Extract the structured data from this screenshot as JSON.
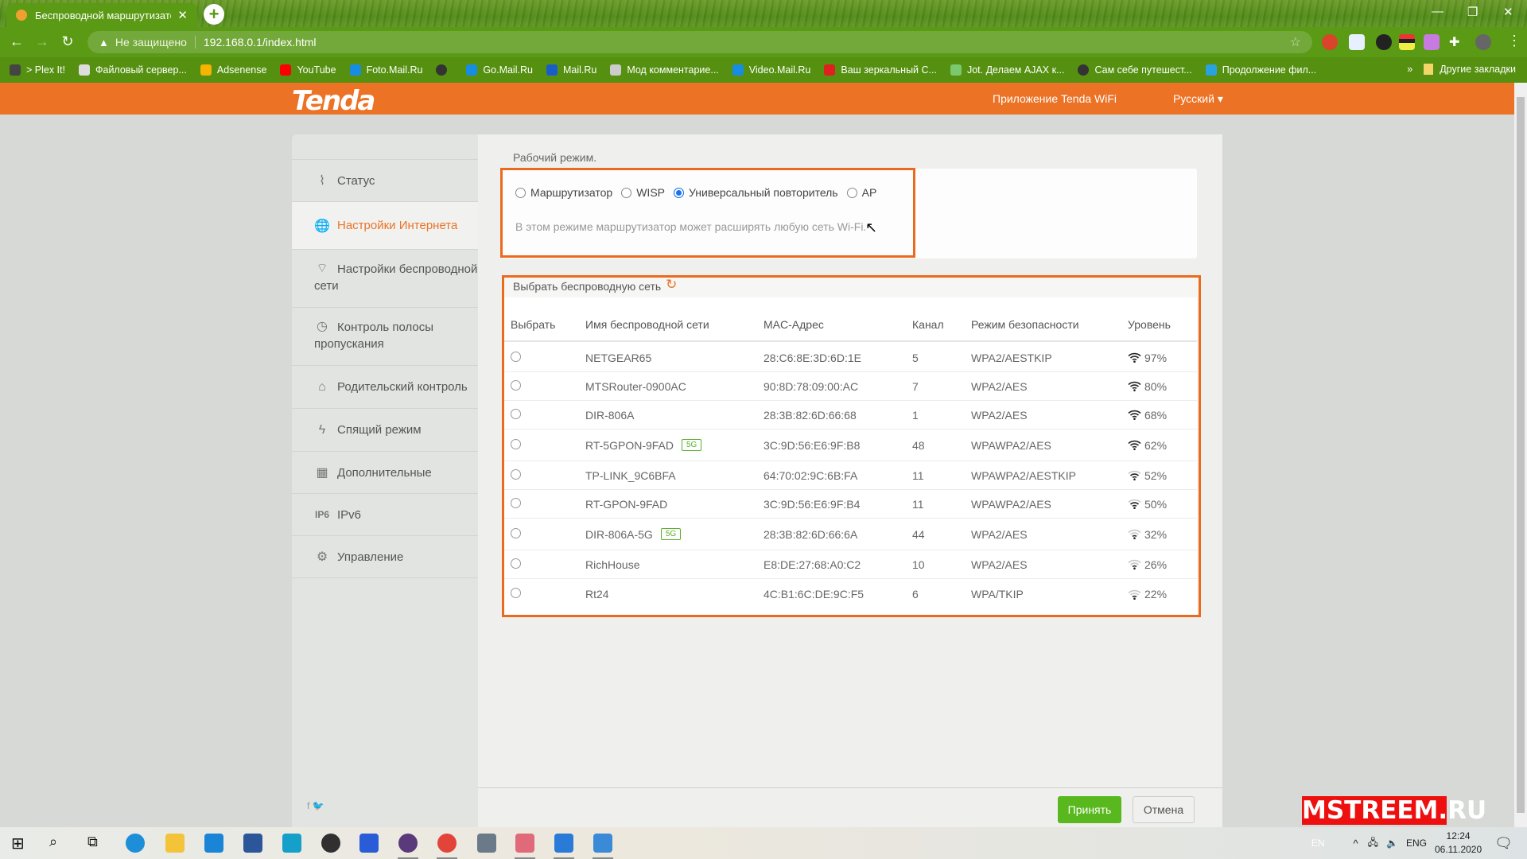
{
  "browser": {
    "tab_title": "Беспроводной маршрутизатор",
    "security_label": "Не защищено",
    "url": "192.168.0.1/index.html",
    "bookmarks": [
      {
        "label": "> Plex It!",
        "color": "#444444"
      },
      {
        "label": "Файловый сервер...",
        "color": "#dddddd"
      },
      {
        "label": "Adsenense",
        "color": "#f4b400"
      },
      {
        "label": "YouTube",
        "color": "#ff0000"
      },
      {
        "label": "Foto.Mail.Ru",
        "color": "#168de2"
      },
      {
        "label": "",
        "color": "#333333"
      },
      {
        "label": "Go.Mail.Ru",
        "color": "#168de2"
      },
      {
        "label": "Mail.Ru",
        "color": "#1a5dc8"
      },
      {
        "label": "Мод комментарие...",
        "color": "#cccccc"
      },
      {
        "label": "Video.Mail.Ru",
        "color": "#168de2"
      },
      {
        "label": "Ваш зеркальный С...",
        "color": "#e02020"
      },
      {
        "label": "Jot. Делаем AJAX к...",
        "color": "#7bc96f"
      },
      {
        "label": "Сам себе путешест...",
        "color": "#333333"
      },
      {
        "label": "Продолжение фил...",
        "color": "#29a3e0"
      }
    ],
    "more_bookmarks": "»",
    "other_bookmarks": "Другие закладки"
  },
  "header": {
    "logo": "Tenda",
    "app_link": "Приложение Tenda WiFi",
    "language": "Русский ▾"
  },
  "sidebar": {
    "items": [
      {
        "label": "Статус",
        "icon": "status-icon",
        "glyph": "⌇"
      },
      {
        "label": "Настройки Интернета",
        "icon": "globe-icon",
        "glyph": "🌐",
        "active": true
      },
      {
        "label": "Настройки беспроводной сети",
        "icon": "wifi-icon",
        "glyph": "⌔"
      },
      {
        "label": "Контроль полосы пропускания",
        "icon": "gauge-icon",
        "glyph": "◷"
      },
      {
        "label": "Родительский контроль",
        "icon": "parental-icon",
        "glyph": "⌂"
      },
      {
        "label": "Спящий режим",
        "icon": "sleep-icon",
        "glyph": "ϟ"
      },
      {
        "label": "Дополнительные",
        "icon": "grid-icon",
        "glyph": "▦"
      },
      {
        "label": "IPv6",
        "icon": "ipv6-icon",
        "glyph": "IP6"
      },
      {
        "label": "Управление",
        "icon": "gear-icon",
        "glyph": "⚙"
      }
    ],
    "social": "f 🐦"
  },
  "mode": {
    "label": "Рабочий режим.",
    "options": [
      "Маршрутизатор",
      "WISP",
      "Универсальный повторитель",
      "AP"
    ],
    "selected": "Универсальный повторитель",
    "description": "В этом режиме маршрутизатор может расширять любую сеть Wi-Fi."
  },
  "networks": {
    "title": "Выбрать беспроводную сеть",
    "columns": [
      "Выбрать",
      "Имя беспроводной сети",
      "MAC-Адрес",
      "Канал",
      "Режим безопасности",
      "Уровень"
    ],
    "rows": [
      {
        "ssid": "NETGEAR65",
        "band": "",
        "mac": "28:C6:8E:3D:6D:1E",
        "channel": "5",
        "security": "WPA2/AESTKIP",
        "level": "97%",
        "bars": 4
      },
      {
        "ssid": "MTSRouter-0900AC",
        "band": "",
        "mac": "90:8D:78:09:00:AC",
        "channel": "7",
        "security": "WPA2/AES",
        "level": "80%",
        "bars": 4
      },
      {
        "ssid": "DIR-806A",
        "band": "",
        "mac": "28:3B:82:6D:66:68",
        "channel": "1",
        "security": "WPA2/AES",
        "level": "68%",
        "bars": 4
      },
      {
        "ssid": "RT-5GPON-9FAD",
        "band": "5G",
        "mac": "3C:9D:56:E6:9F:B8",
        "channel": "48",
        "security": "WPAWPA2/AES",
        "level": "62%",
        "bars": 4
      },
      {
        "ssid": "TP-LINK_9C6BFA",
        "band": "",
        "mac": "64:70:02:9C:6B:FA",
        "channel": "11",
        "security": "WPAWPA2/AESTKIP",
        "level": "52%",
        "bars": 3
      },
      {
        "ssid": "RT-GPON-9FAD",
        "band": "",
        "mac": "3C:9D:56:E6:9F:B4",
        "channel": "11",
        "security": "WPAWPA2/AES",
        "level": "50%",
        "bars": 3
      },
      {
        "ssid": "DIR-806A-5G",
        "band": "5G",
        "mac": "28:3B:82:6D:66:6A",
        "channel": "44",
        "security": "WPA2/AES",
        "level": "32%",
        "bars": 2
      },
      {
        "ssid": "RichHouse",
        "band": "",
        "mac": "E8:DE:27:68:A0:C2",
        "channel": "10",
        "security": "WPA2/AES",
        "level": "26%",
        "bars": 2
      },
      {
        "ssid": "Rt24",
        "band": "",
        "mac": "4C:B1:6C:DE:9C:F5",
        "channel": "6",
        "security": "WPA/TKIP",
        "level": "22%",
        "bars": 2
      }
    ]
  },
  "buttons": {
    "accept": "Принять",
    "cancel": "Отмена"
  },
  "watermark": "MSTREEM.RU",
  "taskbar": {
    "apps": [
      {
        "name": "edge",
        "color": "#1c8fd8"
      },
      {
        "name": "file-explorer",
        "color": "#f3c33a"
      },
      {
        "name": "mail",
        "color": "#1a84d6"
      },
      {
        "name": "word",
        "color": "#2b579a"
      },
      {
        "name": "vegas",
        "color": "#14a0c8"
      },
      {
        "name": "obs",
        "color": "#303030"
      },
      {
        "name": "audacity",
        "color": "#2a5cd8"
      },
      {
        "name": "uplay",
        "color": "#5a3a7a"
      },
      {
        "name": "chrome",
        "color": "#e2443a"
      },
      {
        "name": "calculator",
        "color": "#6b7a88"
      },
      {
        "name": "snipping-tool",
        "color": "#e06a7a"
      },
      {
        "name": "edge-legacy",
        "color": "#2a7ad8"
      },
      {
        "name": "control-panel",
        "color": "#3a8ad8"
      }
    ],
    "lang_indicator": "EN",
    "keyboard_lang": "ENG",
    "time": "12:24",
    "date": "06.11.2020"
  },
  "colors": {
    "accent": "#ec7226",
    "accept": "#58b81e",
    "browser_green": "#5b9a14"
  }
}
